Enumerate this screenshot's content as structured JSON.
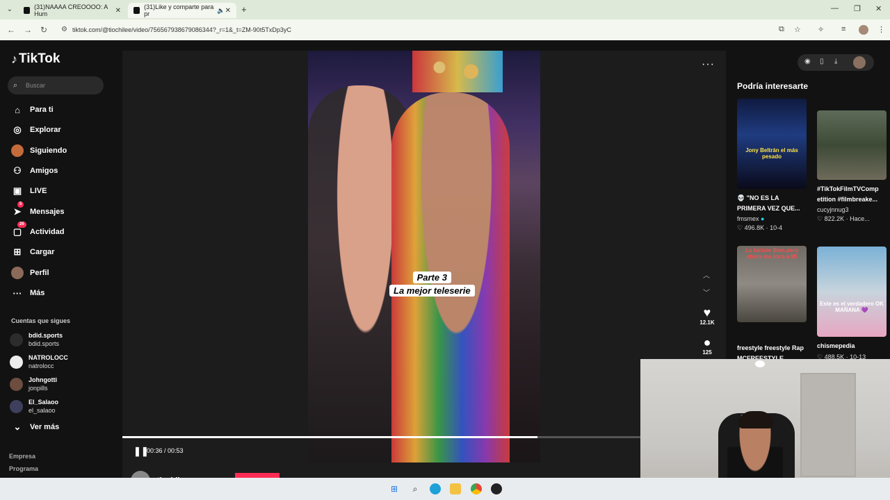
{
  "browser": {
    "tabs": [
      {
        "title": "(31)NAAAA CREOOOO: A Hum"
      },
      {
        "title": "(31)Like y comparte para pr"
      }
    ],
    "new_tab": "+",
    "url": "tiktok.com/@tiochilee/video/7565679386790863​44?_r=1&_t=ZM-90t5TxDp3yC"
  },
  "sidebar": {
    "logo": "TikTok",
    "search_placeholder": "Buscar",
    "nav": [
      {
        "label": "Para ti",
        "icon": "home-icon"
      },
      {
        "label": "Explorar",
        "icon": "compass-icon"
      },
      {
        "label": "Siguiendo",
        "icon": "following-avatar-icon"
      },
      {
        "label": "Amigos",
        "icon": "friends-icon"
      },
      {
        "label": "LIVE",
        "icon": "live-icon"
      },
      {
        "label": "Mensajes",
        "icon": "send-icon",
        "badge": "5"
      },
      {
        "label": "Actividad",
        "icon": "activity-icon",
        "badge": "26"
      },
      {
        "label": "Cargar",
        "icon": "upload-icon"
      },
      {
        "label": "Perfil",
        "icon": "profile-avatar-icon"
      },
      {
        "label": "Más",
        "icon": "more-icon"
      }
    ],
    "following_title": "Cuentas que sigues",
    "following": [
      {
        "name": "bdid.sports",
        "username": "bdid.sports",
        "color": "#2c2c2c"
      },
      {
        "name": "NATROLOCC",
        "username": "natrolocc",
        "color": "#ededed"
      },
      {
        "name": "Johngotti",
        "username": "jonpills",
        "color": "#6d4d3f"
      },
      {
        "name": "El_Salaoo",
        "username": "el_salaoo",
        "color": "#3e3f5c"
      }
    ],
    "see_more": "Ver más",
    "footer": [
      "Empresa",
      "Programa"
    ]
  },
  "video": {
    "caption_line1": "Parte 3",
    "caption_line2": "La mejor teleserie",
    "likes": "12.1K",
    "comments": "125",
    "time": "00:36 / 00:53",
    "progress": 0.688,
    "author": "tiochilee"
  },
  "recommendations": {
    "title": "Podría interesarte",
    "items": [
      {
        "title": "💀 \"NO ES LA PRIMERA VEZ QUE...",
        "user": "fmsmex",
        "stats": "♡ 496.8K · 10-4",
        "overlay": "Jony Beltrán el más pesado"
      },
      {
        "title": "#TikTokFilmTVComp etition #filmbreake...",
        "user": "cucyjnnug3",
        "stats": "♡ 822.2K · Hace...",
        "overlay": ""
      },
      {
        "title": "freestyle freestyle Rap MCFREESTYLE",
        "user": "",
        "stats": "",
        "overlay": "Lo hiciste Bien pero ahora me toca a MI"
      },
      {
        "title": "chismepedia",
        "user": "",
        "stats": "♡ 488.5K · 10-13",
        "overlay": "Este es el verdadero OK MAÑANA 💜"
      }
    ]
  },
  "colors": {
    "accent": "#fe2c55",
    "background": "#121212"
  }
}
